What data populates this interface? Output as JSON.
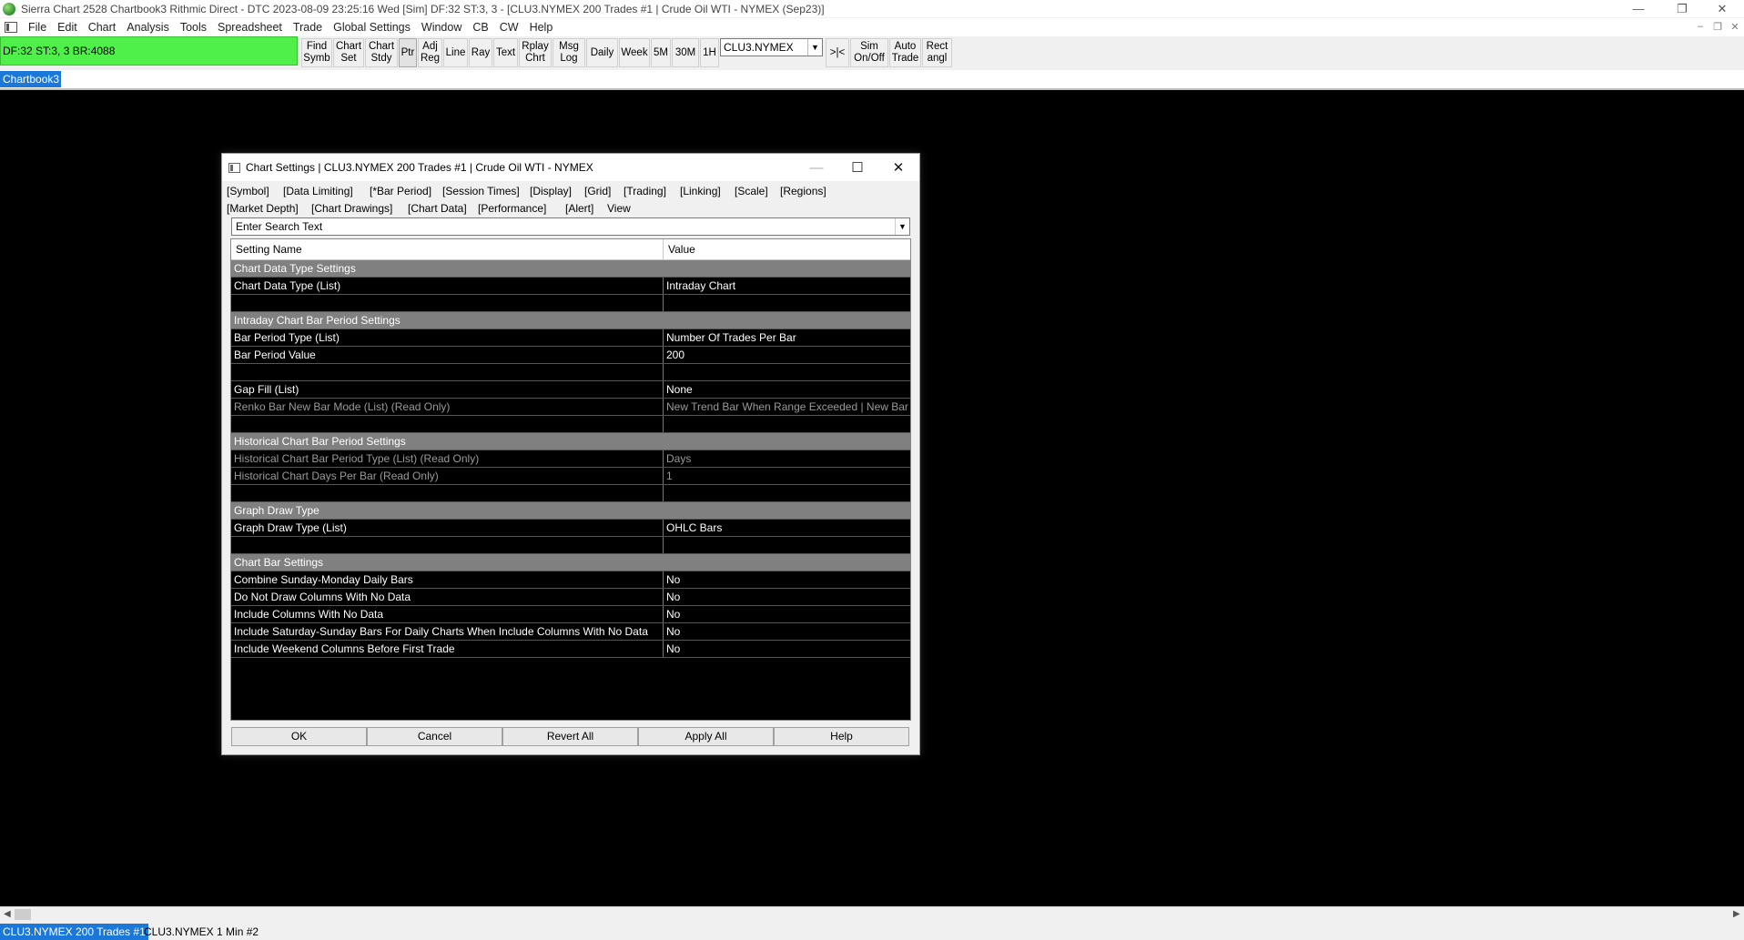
{
  "window": {
    "title": "Sierra Chart 2528 Chartbook3 Rithmic Direct - DTC 2023-08-09  23:25:16 Wed [Sim]  DF:32  ST:3, 3 - [CLU3.NYMEX  200 Trades #1 | Crude Oil WTI - NYMEX (Sep23)]"
  },
  "menu": [
    "File",
    "Edit",
    "Chart",
    "Analysis",
    "Tools",
    "Spreadsheet",
    "Trade",
    "Global Settings",
    "Window",
    "CB",
    "CW",
    "Help"
  ],
  "toolbar": {
    "status": "DF:32  ST:3, 3  BR:4088",
    "status_color": "#50f04a",
    "buttons": [
      "Find\nSymb",
      "Chart\nSet",
      "Chart\nStdy",
      "Ptr",
      "Adj\nReg",
      "Line",
      "Ray",
      "Text",
      "Rplay\nChrt",
      "Msg\nLog",
      "Daily",
      "Week",
      "5M",
      "30M",
      "1H"
    ],
    "symbol": "CLU3.NYMEX",
    "right_buttons": [
      ">|<",
      "Sim\nOn/Off",
      "Auto\nTrade",
      "Rect\nangl"
    ]
  },
  "chartbook_tab": "Chartbook3",
  "dialog": {
    "title": "Chart Settings | CLU3.NYMEX  200 Trades #1 | Crude Oil WTI - NYMEX",
    "tabs_row1": [
      "[Symbol]",
      "[Data Limiting]",
      "[*Bar Period]",
      "[Session Times]",
      "[Display]",
      "[Grid]",
      "[Trading]",
      "[Linking]",
      "[Scale]",
      "[Regions]"
    ],
    "tabs_row2": [
      "[Market Depth]",
      "[Chart Drawings]",
      "[Chart Data]",
      "[Performance]",
      "[Alert]",
      "View"
    ],
    "search_placeholder": "Enter Search Text",
    "col_name": "Setting Name",
    "col_value": "Value",
    "rows": [
      {
        "type": "section",
        "name": "Chart Data Type Settings",
        "value": ""
      },
      {
        "type": "row",
        "name": "Chart Data Type (List)",
        "value": "Intraday Chart"
      },
      {
        "type": "blank",
        "name": "",
        "value": ""
      },
      {
        "type": "section",
        "name": "Intraday Chart Bar Period Settings",
        "value": ""
      },
      {
        "type": "row",
        "name": "Bar Period Type (List)",
        "value": "Number Of Trades Per Bar"
      },
      {
        "type": "row",
        "name": "Bar Period Value",
        "value": "200"
      },
      {
        "type": "blank",
        "name": "",
        "value": ""
      },
      {
        "type": "row",
        "name": "Gap Fill (List)",
        "value": "None"
      },
      {
        "type": "readonly",
        "name": "Renko Bar New Bar Mode (List) (Read Only)",
        "value": "New Trend Bar When Range Exceeded | New Bar Wh"
      },
      {
        "type": "blank",
        "name": "",
        "value": ""
      },
      {
        "type": "section",
        "name": "Historical Chart Bar Period Settings",
        "value": ""
      },
      {
        "type": "readonly",
        "name": "Historical Chart Bar Period Type (List) (Read Only)",
        "value": "Days"
      },
      {
        "type": "readonly",
        "name": "Historical Chart Days Per Bar (Read Only)",
        "value": "1"
      },
      {
        "type": "blank",
        "name": "",
        "value": ""
      },
      {
        "type": "section",
        "name": "Graph Draw Type",
        "value": ""
      },
      {
        "type": "row",
        "name": "Graph Draw Type (List)",
        "value": "OHLC Bars"
      },
      {
        "type": "blank",
        "name": "",
        "value": ""
      },
      {
        "type": "section",
        "name": "Chart Bar Settings",
        "value": ""
      },
      {
        "type": "row",
        "name": "Combine Sunday-Monday Daily Bars",
        "value": "No"
      },
      {
        "type": "row",
        "name": "Do Not Draw Columns With No Data",
        "value": "No"
      },
      {
        "type": "row",
        "name": "Include Columns With No Data",
        "value": "No"
      },
      {
        "type": "row",
        "name": "Include Saturday-Sunday Bars For Daily Charts When Include Columns With No Data",
        "value": "No"
      },
      {
        "type": "row",
        "name": "Include Weekend Columns Before First Trade",
        "value": "No"
      }
    ],
    "buttons": [
      "OK",
      "Cancel",
      "Revert All",
      "Apply All",
      "Help"
    ]
  },
  "bottom_tabs": [
    "CLU3.NYMEX  200 Trades #1",
    "CLU3.NYMEX  1 Min  #2"
  ],
  "colors": {
    "accent": "#1b78d8",
    "workspace": "#000000",
    "section_row": "#808080"
  }
}
